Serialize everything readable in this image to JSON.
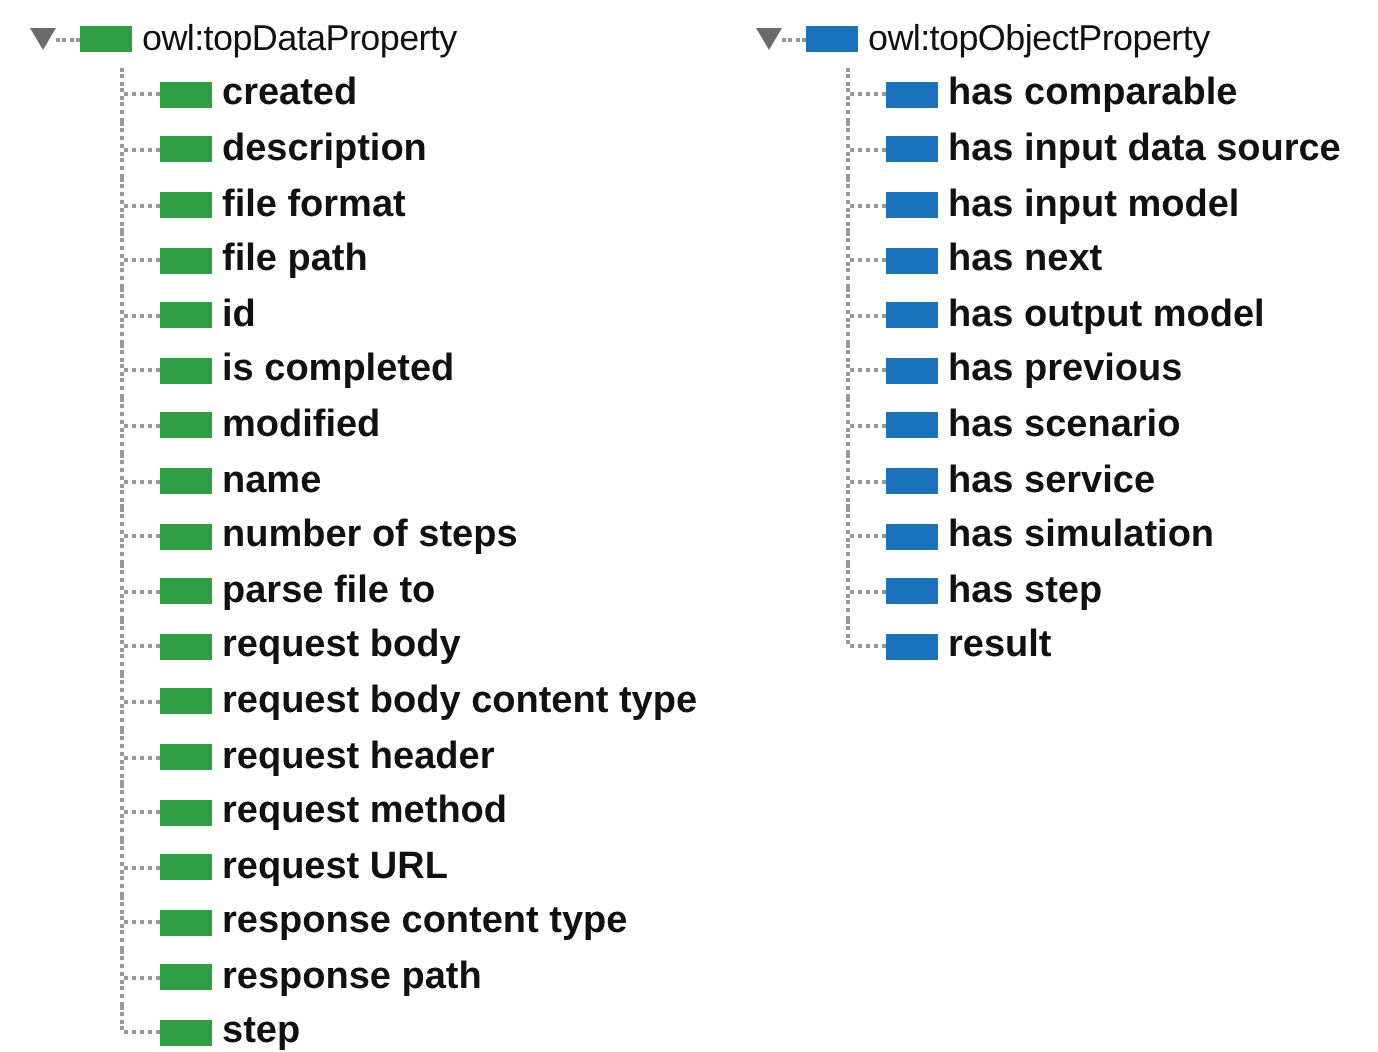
{
  "trees": [
    {
      "label": "owl:topDataProperty",
      "color": "#2ea043",
      "expanded": true,
      "children": [
        {
          "label": "created"
        },
        {
          "label": "description"
        },
        {
          "label": "file format"
        },
        {
          "label": "file path"
        },
        {
          "label": "id"
        },
        {
          "label": "is completed"
        },
        {
          "label": "modified"
        },
        {
          "label": "name"
        },
        {
          "label": "number of steps"
        },
        {
          "label": "parse file to"
        },
        {
          "label": "request body"
        },
        {
          "label": "request body content type"
        },
        {
          "label": "request header"
        },
        {
          "label": "request method"
        },
        {
          "label": "request URL"
        },
        {
          "label": "response content type"
        },
        {
          "label": "response path"
        },
        {
          "label": "step"
        }
      ]
    },
    {
      "label": "owl:topObjectProperty",
      "color": "#1a73b8",
      "expanded": true,
      "children": [
        {
          "label": "has comparable"
        },
        {
          "label": "has input data source"
        },
        {
          "label": "has input model"
        },
        {
          "label": "has next"
        },
        {
          "label": "has output model"
        },
        {
          "label": "has previous"
        },
        {
          "label": "has scenario"
        },
        {
          "label": "has service"
        },
        {
          "label": "has simulation"
        },
        {
          "label": "has step"
        },
        {
          "label": "result"
        }
      ]
    }
  ]
}
